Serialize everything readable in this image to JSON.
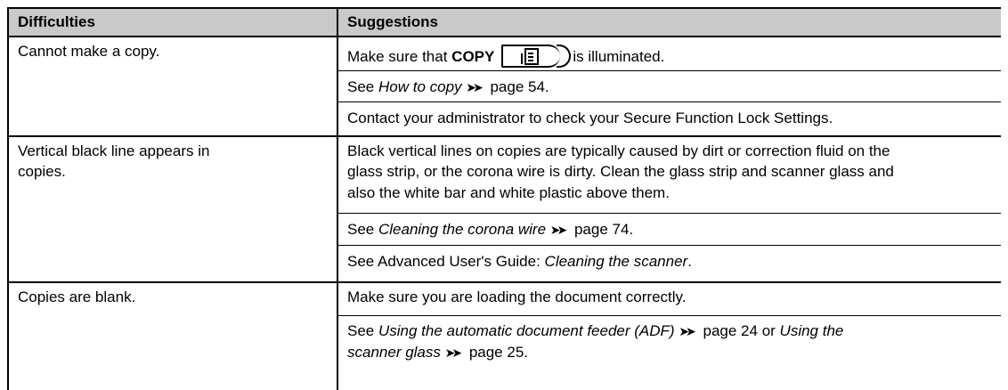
{
  "header": {
    "col1": "Difficulties",
    "col2": "Suggestions"
  },
  "rows": [
    {
      "difficulty": [
        "Cannot make a copy."
      ],
      "suggestions": {
        "s1": {
          "pre": "Make sure that ",
          "bold": "COPY",
          "post": "is illuminated.",
          "key_icon": "copy-key-icon"
        },
        "s2": {
          "pre": "See ",
          "ital": "How to copy",
          "arrows": "➤➤",
          "post": " page 54."
        },
        "s3": "Contact your administrator to check your Secure Function Lock Settings."
      }
    },
    {
      "difficulty": [
        "Vertical black line appears in",
        "copies."
      ],
      "suggestions": {
        "s1": [
          "Black vertical lines on copies are typically caused by dirt or correction fluid on the",
          "glass strip, or the corona wire is dirty. Clean the glass strip and scanner glass and",
          "also the white bar and white plastic above them."
        ],
        "s2": {
          "pre": "See ",
          "ital": "Cleaning the corona wire",
          "arrows": "➤➤",
          "post": " page 74."
        },
        "s3": {
          "pre": "See Advanced User's Guide: ",
          "ital": "Cleaning the scanner",
          "post": "."
        }
      }
    },
    {
      "difficulty": [
        "Copies are blank."
      ],
      "suggestions": {
        "s1": "Make sure you are loading the document correctly.",
        "s2": {
          "pre": "See ",
          "ital1": "Using the automatic document feeder (ADF)",
          "arrows1": "➤➤",
          "mid": " page 24 or ",
          "ital2": "Using the",
          "ital3": "scanner glass",
          "arrows2": "➤➤",
          "post": " page 25."
        }
      }
    }
  ]
}
